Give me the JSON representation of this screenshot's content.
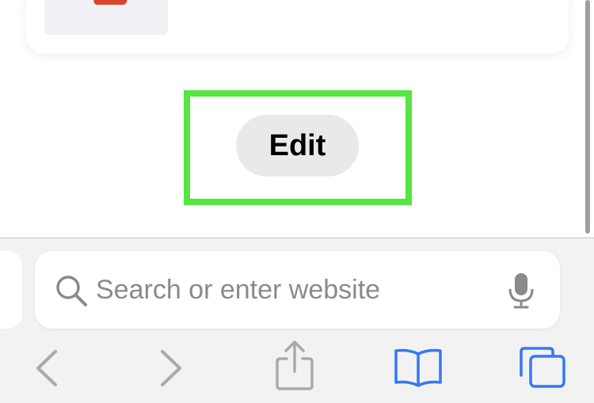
{
  "bookmark_card": {
    "thumbnail_icon": "red-app-icon"
  },
  "edit_button": {
    "label": "Edit"
  },
  "address_bar": {
    "placeholder": "Search or enter website",
    "search_icon": "magnifying-glass-icon",
    "mic_icon": "microphone-icon"
  },
  "toolbar": {
    "icons": [
      "chevron-left-icon",
      "chevron-right-icon",
      "share-icon",
      "book-icon",
      "tabs-icon"
    ]
  },
  "colors": {
    "highlight": "#55e641",
    "accent": "#3478f6",
    "disabled": "#a9a9ae",
    "toolbar_bg": "#f2f2f2",
    "button_bg": "#e9e9eb"
  }
}
